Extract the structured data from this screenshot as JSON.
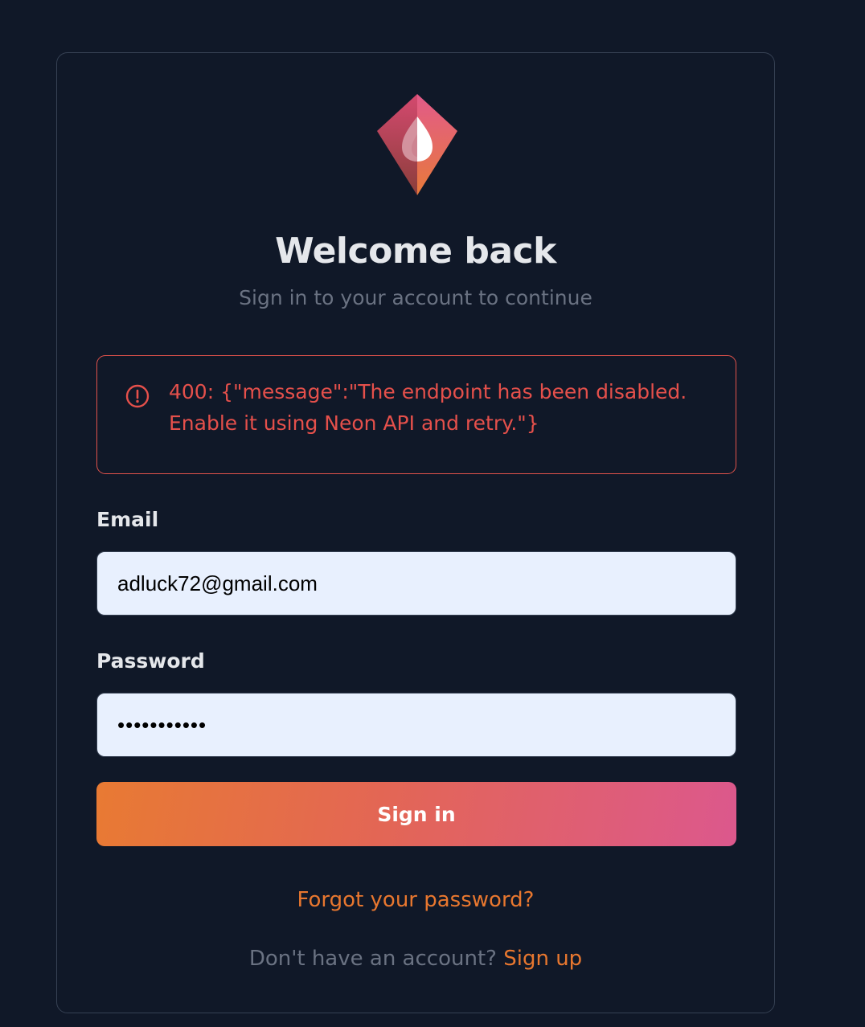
{
  "header": {
    "title": "Welcome back",
    "subtitle": "Sign in to your account to continue"
  },
  "alert": {
    "icon": "alert-circle-icon",
    "message": "400: {\"message\":\"The endpoint has been disabled. Enable it using Neon API and retry.\"}",
    "color": "#e5504b"
  },
  "form": {
    "email_label": "Email",
    "email_value": "adluck72@gmail.com",
    "password_label": "Password",
    "password_value": "•••••••••••",
    "submit_label": "Sign in"
  },
  "links": {
    "forgot_password": "Forgot your password?",
    "signup_prompt": "Don't have an account?",
    "signup_label": "Sign up"
  },
  "colors": {
    "background": "#101828",
    "accent": "#e8772f",
    "gradient_start": "#e87a33",
    "gradient_end": "#dc588d",
    "error": "#e5504b"
  },
  "logo": {
    "icon": "diamond-flame-logo-icon"
  }
}
